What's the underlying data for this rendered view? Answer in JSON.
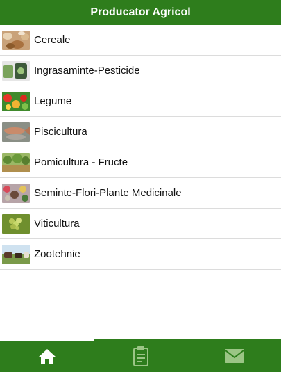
{
  "header": {
    "title": "Producator Agricol"
  },
  "categories": [
    {
      "label": "Cereale",
      "thumb": "grain-photo"
    },
    {
      "label": "Ingrasaminte-Pesticide",
      "thumb": "fertilizer-photo"
    },
    {
      "label": "Legume",
      "thumb": "vegetables-photo"
    },
    {
      "label": "Piscicultura",
      "thumb": "fish-photo"
    },
    {
      "label": "Pomicultura - Fructe",
      "thumb": "orchard-photo"
    },
    {
      "label": "Seminte-Flori-Plante Medicinale",
      "thumb": "seeds-photo"
    },
    {
      "label": "Viticultura",
      "thumb": "grapes-photo"
    },
    {
      "label": "Zootehnie",
      "thumb": "livestock-photo"
    }
  ],
  "tabbar": {
    "tabs": [
      {
        "icon": "home-icon",
        "active": true
      },
      {
        "icon": "clipboard-icon",
        "active": false
      },
      {
        "icon": "mail-icon",
        "active": false
      }
    ]
  },
  "colors": {
    "brand": "#2e7d1c",
    "divider": "#dcdcdc",
    "text": "#111111"
  }
}
